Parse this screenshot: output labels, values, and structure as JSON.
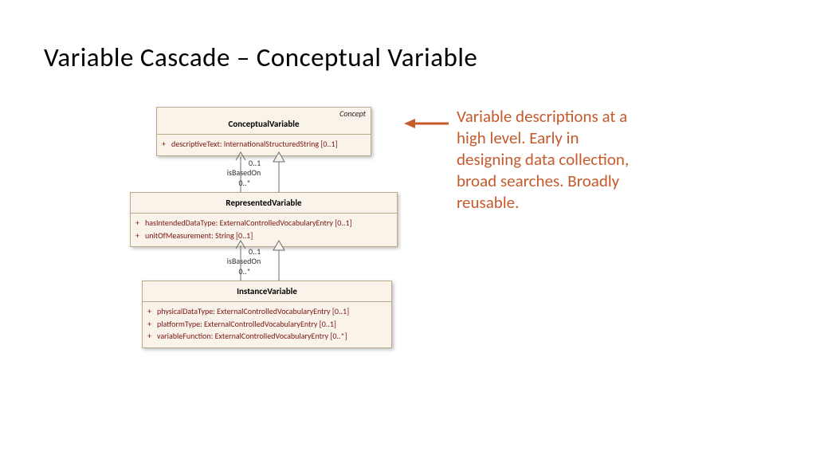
{
  "title": "Variable Cascade – Conceptual Variable",
  "callout": "Variable descriptions at a high level. Early in designing data collection, broad searches. Broadly reusable.",
  "classes": {
    "conceptual": {
      "stereotype": "Concept",
      "name": "ConceptualVariable",
      "attrs": [
        "descriptiveText: InternationalStructuredString [0..1]"
      ]
    },
    "represented": {
      "name": "RepresentedVariable",
      "attrs": [
        "hasIntendedDataType: ExternalControlledVocabularyEntry [0..1]",
        "unitOfMeasurement: String [0..1]"
      ]
    },
    "instance": {
      "name": "InstanceVariable",
      "attrs": [
        "physicalDataType: ExternalControlledVocabularyEntry [0..1]",
        "platformType: ExternalControlledVocabularyEntry [0..1]",
        "variableFunction: ExternalControlledVocabularyEntry [0..*]"
      ]
    }
  },
  "conn1": {
    "upperMult": "0..1",
    "label": "isBasedOn",
    "lowerMult": "0..*"
  },
  "conn2": {
    "upperMult": "0..1",
    "label": "isBasedOn",
    "lowerMult": "0..*"
  }
}
